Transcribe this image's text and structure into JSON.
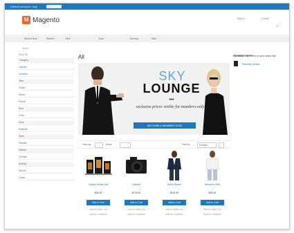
{
  "topbar": {
    "welcome": "Default welcome msg!",
    "pill": ""
  },
  "header": {
    "logo_text": "Magento",
    "logo_mark": "M",
    "sign_in": "Sign In",
    "create_account": "Create",
    "cart_icon": "cart-icon"
  },
  "nav": {
    "items": [
      "What's New",
      "Women",
      "Men",
      "Gear",
      "Training",
      "Sale"
    ]
  },
  "breadcrumb": "Home",
  "sidebar": {
    "title": "Shop By",
    "items": [
      {
        "label": "Category",
        "head": true
      },
      {
        "label": "Jackets"
      },
      {
        "label": "Hoodies"
      },
      {
        "label": "Tees",
        "head": true
      },
      {
        "label": "Tanks"
      },
      {
        "label": "Pants"
      },
      {
        "label": "Shorts"
      },
      {
        "label": "Size",
        "head": true
      },
      {
        "label": "Color"
      },
      {
        "label": "Price",
        "head": true
      },
      {
        "label": "Material"
      },
      {
        "label": "Style",
        "head": true
      },
      {
        "label": "Gender"
      },
      {
        "label": "Pattern",
        "head": true
      },
      {
        "label": "Climate"
      },
      {
        "label": "Activity",
        "head": true
      },
      {
        "label": "Sleeve"
      },
      {
        "label": "Collar"
      }
    ]
  },
  "main": {
    "title": "All",
    "banner": {
      "sky": "SKY",
      "lounge": "LOUNGE",
      "dots": "•••",
      "exclusive": "exclusive prices visible for members only",
      "cta": "BECOME A MEMBER NOW"
    },
    "toolbar": {
      "view_label": "View as",
      "items_label": "Items",
      "sort_label": "Sort By",
      "position": "Position"
    },
    "products": [
      {
        "name": "Candle Holder Set",
        "price": "$34.00",
        "add": "Add to Cart",
        "wishlist": "Add to Wish List",
        "compare": "Add to Compare",
        "img": "candles"
      },
      {
        "name": "Camera",
        "price": "$275.00",
        "add": "Add to Cart",
        "wishlist": "Add to Wish List",
        "compare": "Add to Compare",
        "img": "camera"
      },
      {
        "name": "Men's Blazer",
        "price": "$110.00",
        "add": "Add to Cart",
        "wishlist": "Add to Wish List",
        "compare": "Add to Compare",
        "img": "blazer"
      },
      {
        "name": "Women's Shirt",
        "price": "$45.00",
        "add": "Add to Cart",
        "wishlist": "Add to Wish List",
        "compare": "Add to Compare",
        "img": "shirt"
      }
    ]
  },
  "right": {
    "compare_title": "Compare Products",
    "recent_item": "Recently viewed",
    "wishlist_title": "My Wish List",
    "wishlist_text": "You have no items in your wish list."
  },
  "colors": {
    "accent": "#1979c3",
    "brand": "#f26322"
  }
}
